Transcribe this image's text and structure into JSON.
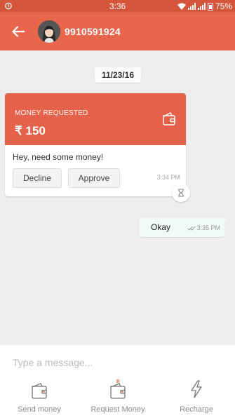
{
  "status_bar": {
    "time": "3:36",
    "battery": "75%"
  },
  "header": {
    "contact_name": "9910591924"
  },
  "chat": {
    "date_chip": "11/23/16",
    "request_card": {
      "label": "MONEY REQUESTED",
      "amount": "₹ 150",
      "message": "Hey, need some money!",
      "decline_label": "Decline",
      "approve_label": "Approve",
      "time": "3:34 PM"
    },
    "outgoing_message": {
      "text": "Okay",
      "time": "3:35 PM"
    }
  },
  "composer": {
    "placeholder": "Type a message...",
    "actions": [
      {
        "label": "Send money",
        "icon": "wallet-send-icon"
      },
      {
        "label": "Request Money",
        "icon": "wallet-request-icon"
      },
      {
        "label": "Recharge",
        "icon": "lightning-icon"
      }
    ]
  },
  "colors": {
    "app_bar": "#e8664b",
    "status_bar": "#d4553a",
    "card_header": "#e4614a",
    "outgoing_bubble": "#f1fbf6"
  }
}
